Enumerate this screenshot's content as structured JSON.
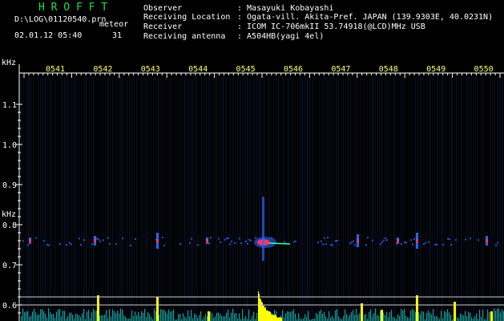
{
  "header": {
    "app_name": "H R O F F T",
    "log_path": "D:\\LOG\\01120540.prn",
    "mode_label": "meteor",
    "datetime": "02.01.12 05:40",
    "count": "31",
    "info": [
      {
        "label": "Observer",
        "value": ": Masayuki Kobayashi"
      },
      {
        "label": "Receiving Location",
        "value": ": Ogata-vill. Akita-Pref. JAPAN (139.9303E, 40.0231N)"
      },
      {
        "label": "Receiver",
        "value": ": ICOM IC-706mkII 53.74918(@LCD)MHz USB"
      },
      {
        "label": "Receiving antenna",
        "value": ": A504HB(yagi 4el)"
      }
    ]
  },
  "axis": {
    "unit_top": "kHz",
    "unit_mid": "kHz",
    "y_labels": [
      "1.1",
      "1.0",
      "0.9",
      "0.8",
      "0.7",
      "0.6"
    ],
    "time_labels": [
      "0541",
      "0542",
      "0543",
      "0544",
      "0545",
      "0546",
      "0547",
      "0548",
      "0549",
      "0550"
    ]
  },
  "colors": {
    "axis": "#ffffff",
    "time_label": "#ffff66",
    "header_green": "#22dd44",
    "meteor_core": "#ff3366",
    "trace": "#2266ff",
    "bar": "#ffff00",
    "noise_bar": "#22dddd",
    "guide_line": "#cccccc"
  }
}
